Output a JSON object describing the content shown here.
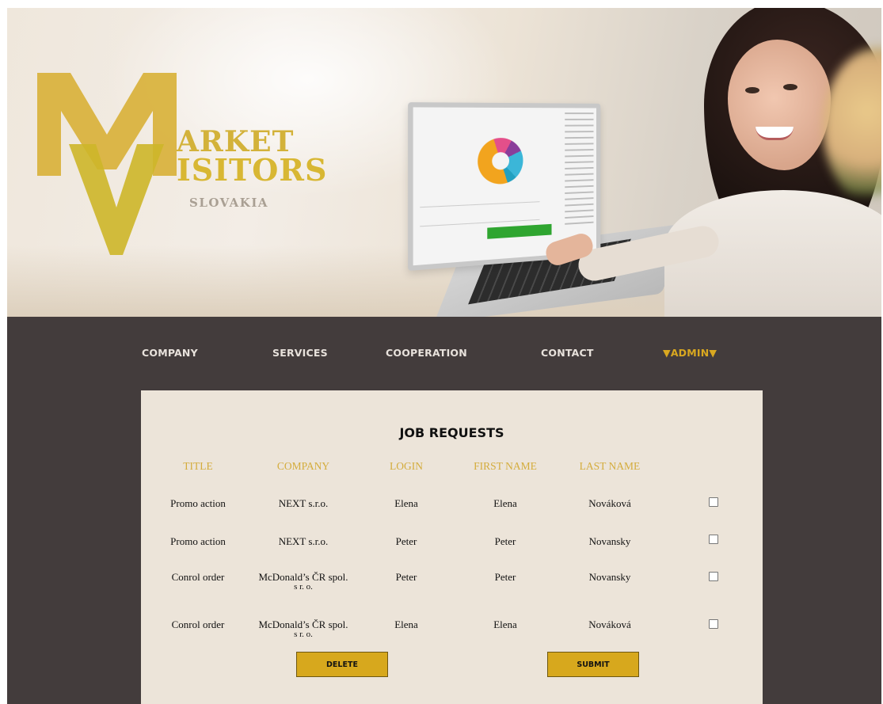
{
  "brand": {
    "logo_line1": "ARKET",
    "logo_line2": "ISITORS",
    "logo_sub": "SLOVAKIA",
    "logo_letters": "MV"
  },
  "nav": {
    "items": [
      {
        "label": "COMPANY"
      },
      {
        "label": "SERVICES"
      },
      {
        "label": "COOPERATION"
      },
      {
        "label": "CONTACT"
      },
      {
        "label": "▼ADMIN▼",
        "active": true
      }
    ]
  },
  "job_requests": {
    "title": "JOB REQUESTS",
    "columns": [
      "TITLE",
      "COMPANY",
      "LOGIN",
      "FIRST NAME",
      "LAST NAME"
    ],
    "rows": [
      {
        "title": "Promo action",
        "company": "NEXT s.r.o.",
        "company_line2": "",
        "login": "Elena",
        "first_name": "Elena",
        "last_name": "Nováková",
        "checked": false
      },
      {
        "title": "Promo action",
        "company": "NEXT s.r.o.",
        "company_line2": "",
        "login": "Peter",
        "first_name": "Peter",
        "last_name": "Novansky",
        "checked": false
      },
      {
        "title": "Conrol order",
        "company": "McDonald’s ČR spol.",
        "company_line2": "s r. o.",
        "login": "Peter",
        "first_name": "Peter",
        "last_name": "Novansky",
        "checked": false
      },
      {
        "title": "Conrol order",
        "company": "McDonald’s ČR spol.",
        "company_line2": "s r. o.",
        "login": "Elena",
        "first_name": "Elena",
        "last_name": "Nováková",
        "checked": false
      }
    ],
    "delete_label": "DELETE",
    "submit_label": "SUBMIT"
  },
  "colors": {
    "accent": "#d9a820",
    "nav_bg": "#433c3c",
    "panel_bg": "#ece4d9",
    "header_text": "#d4ac3c"
  }
}
